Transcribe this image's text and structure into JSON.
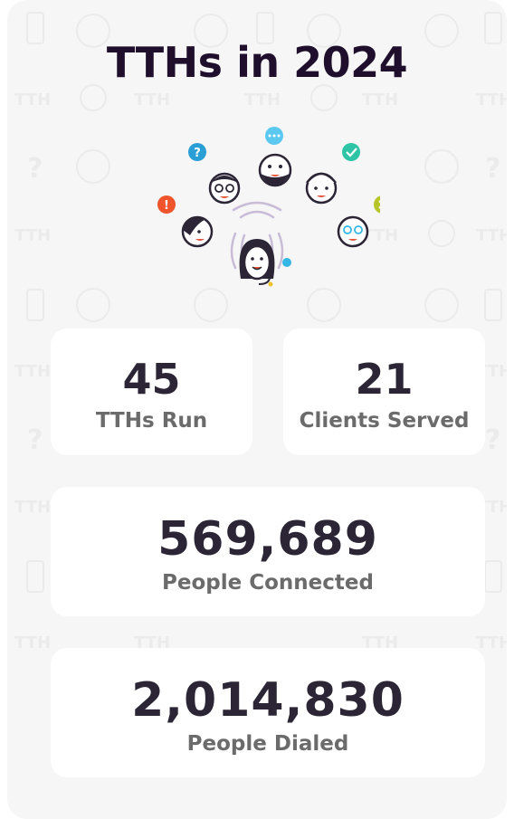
{
  "title": "TTHs in 2024",
  "stats": [
    {
      "value": "45",
      "label": "TTHs Run"
    },
    {
      "value": "21",
      "label": "Clients Served"
    },
    {
      "value": "569,689",
      "label": "People Connected"
    },
    {
      "value": "2,014,830",
      "label": "People Dialed"
    }
  ],
  "pattern_text": "TTH",
  "colors": {
    "card_bg": "#f6f6f6",
    "title": "#1f0f2c",
    "value": "#2b2535",
    "label": "#6b6b6b",
    "bubble_question": "#2a9fd6",
    "bubble_chat": "#5bc8f0",
    "bubble_check": "#2ec4a6",
    "bubble_cancel": "#b7c42a",
    "bubble_alert": "#f0542a"
  }
}
